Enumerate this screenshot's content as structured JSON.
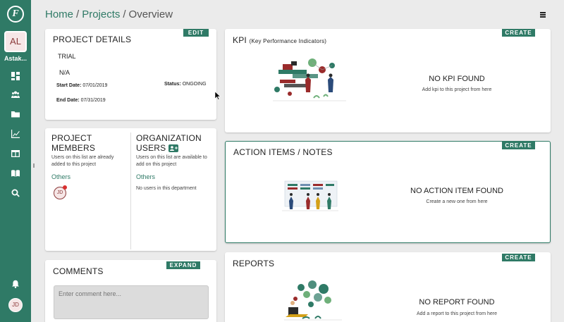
{
  "app": {
    "logo_glyph": "F",
    "user_initials": "AL",
    "user_name": "Astak...",
    "bottom_initials": "JD"
  },
  "breadcrumb": {
    "home": "Home",
    "projects": "Projects",
    "current": "Overview",
    "separator": "/"
  },
  "project_details": {
    "title": "PROJECT DETAILS",
    "edit_label": "EDIT",
    "name": "TRIAL",
    "description": "N/A",
    "start_label": "Start Date:",
    "start_value": "07/01/2019",
    "status_label": "Status:",
    "status_value": "ONGOING",
    "end_label": "End Date:",
    "end_value": "07/31/2019"
  },
  "members": {
    "title_line1": "PROJECT",
    "title_line2": "MEMBERS",
    "subtitle": "Users on this list are already added to this project",
    "group_label": "Others",
    "member_initials": "JD"
  },
  "org_users": {
    "title_line1": "ORGANIZATION",
    "title_line2": "USERS",
    "subtitle": "Users on this list are available to add on this project",
    "group_label": "Others",
    "empty_text": "No users in this department"
  },
  "comments": {
    "title": "COMMENTS",
    "expand_label": "EXPAND",
    "placeholder": "Enter comment here..."
  },
  "kpi": {
    "title": "KPI",
    "title_suffix": "(Key Performance Indicators)",
    "create_label": "CREATE",
    "empty_title": "NO KPI FOUND",
    "empty_sub": "Add kpi to this project from here"
  },
  "action_items": {
    "title": "ACTION ITEMS / NOTES",
    "create_label": "CREATE",
    "empty_title": "NO ACTION ITEM FOUND",
    "empty_sub": "Create a new one from here"
  },
  "reports": {
    "title": "REPORTS",
    "create_label": "CREATE",
    "empty_title": "NO REPORT FOUND",
    "empty_sub": "Add a report to this project from here"
  },
  "colors": {
    "brand": "#2f7a66",
    "background": "#ebebeb",
    "avatar_bg": "#f6e7e7",
    "avatar_text": "#8c3a3a"
  }
}
